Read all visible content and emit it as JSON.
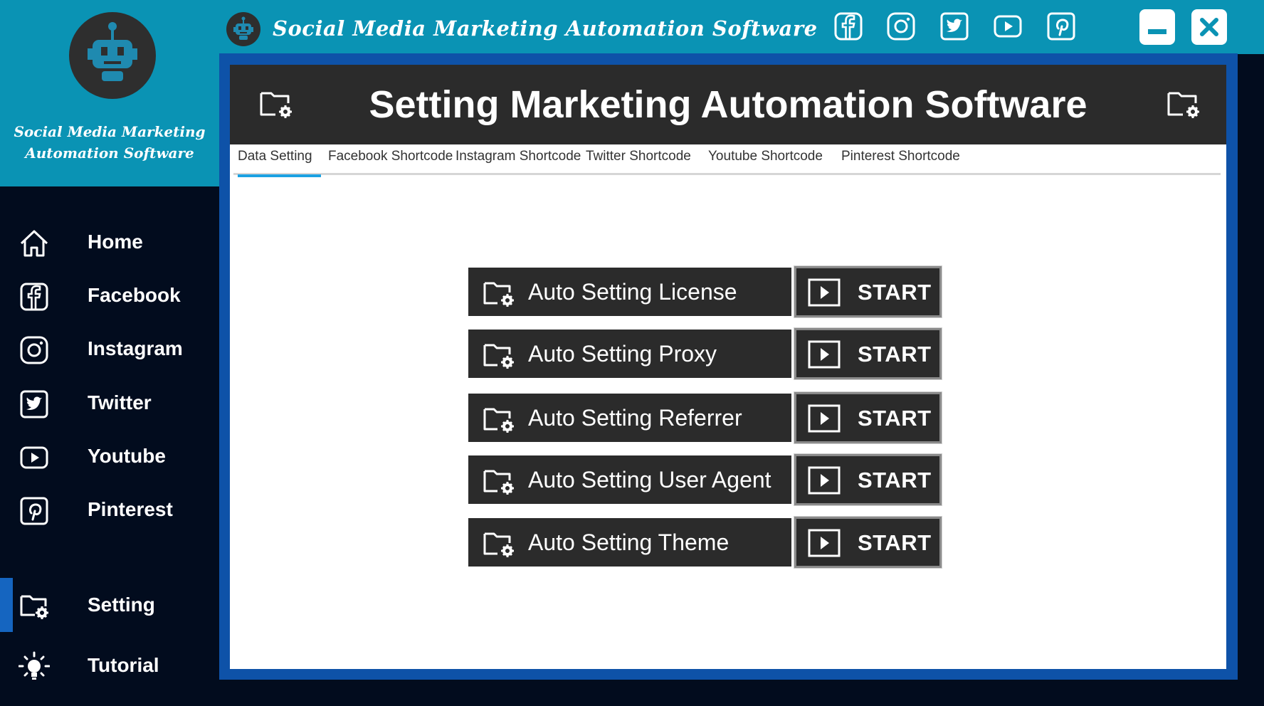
{
  "app": {
    "title": "Social Media Marketing Automation Software",
    "brand_line1": "Social Media Marketing",
    "brand_line2": "Automation Software"
  },
  "topbar": {
    "social_icons": [
      "facebook-icon",
      "instagram-icon",
      "twitter-icon",
      "youtube-icon",
      "pinterest-icon"
    ],
    "window_controls": [
      "minimize-icon",
      "close-icon"
    ]
  },
  "sidebar": {
    "items": [
      {
        "label": "Home",
        "icon": "home-icon",
        "active": false
      },
      {
        "label": "Facebook",
        "icon": "facebook-icon",
        "active": false
      },
      {
        "label": "Instagram",
        "icon": "instagram-icon",
        "active": false
      },
      {
        "label": "Twitter",
        "icon": "twitter-icon",
        "active": false
      },
      {
        "label": "Youtube",
        "icon": "youtube-icon",
        "active": false
      },
      {
        "label": "Pinterest",
        "icon": "pinterest-icon",
        "active": false
      },
      {
        "label": "Setting",
        "icon": "folder-settings-icon",
        "active": true
      },
      {
        "label": "Tutorial",
        "icon": "lightbulb-icon",
        "active": false
      }
    ]
  },
  "main": {
    "title": "Setting Marketing Automation Software",
    "tabs": [
      {
        "label": "Data Setting",
        "active": true
      },
      {
        "label": "Facebook Shortcode",
        "active": false
      },
      {
        "label": "Instagram Shortcode",
        "active": false
      },
      {
        "label": "Twitter Shortcode",
        "active": false
      },
      {
        "label": "Youtube Shortcode",
        "active": false
      },
      {
        "label": "Pinterest Shortcode",
        "active": false
      }
    ],
    "rows": [
      {
        "label": "Auto Setting License",
        "button": "START"
      },
      {
        "label": "Auto Setting Proxy",
        "button": "START"
      },
      {
        "label": "Auto Setting Referrer",
        "button": "START"
      },
      {
        "label": "Auto Setting User Agent",
        "button": "START"
      },
      {
        "label": "Auto Setting Theme",
        "button": "START"
      }
    ]
  },
  "colors": {
    "header_teal": "#0a93b4",
    "sidebar_bg": "#020c1e",
    "panel_border": "#0e52a8",
    "dark_bar": "#2b2b2b",
    "tab_accent": "#1ba1e2",
    "active_indicator": "#1565c0"
  }
}
